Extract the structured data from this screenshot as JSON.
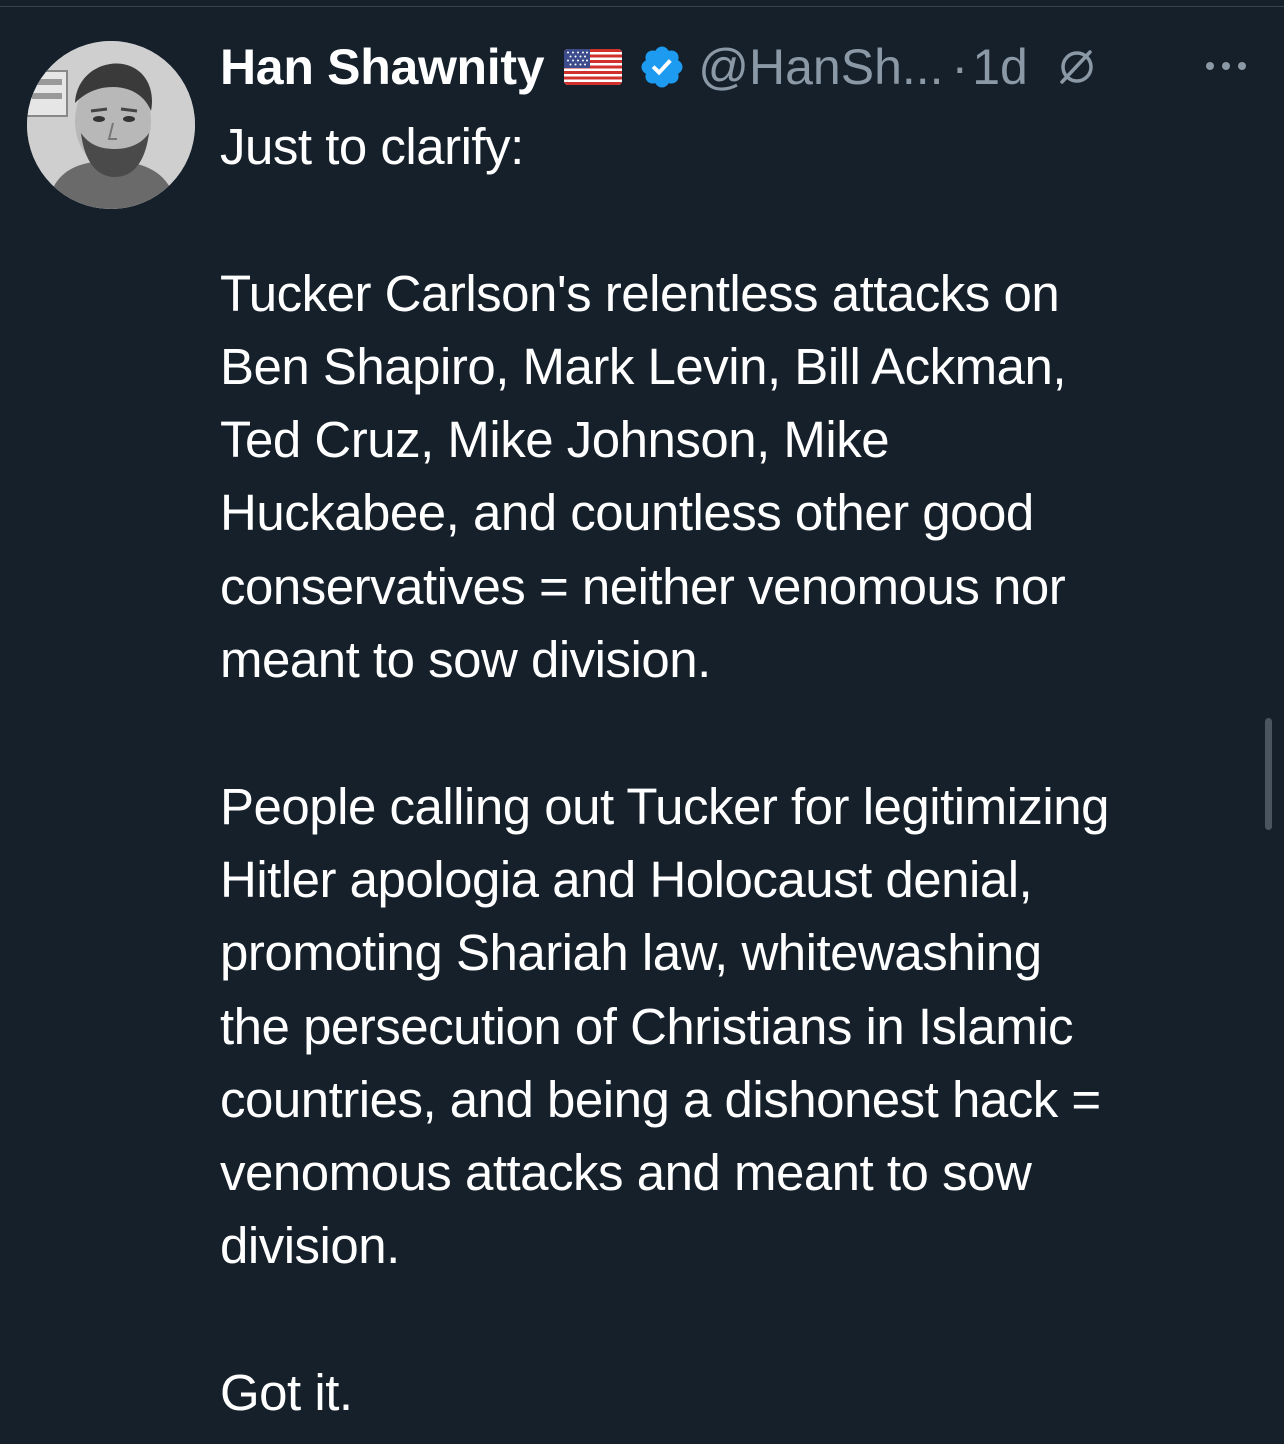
{
  "tweet": {
    "author": {
      "display_name": "Han Shawnity",
      "flag_emoji": "🇺🇸",
      "handle": "@HanSh...",
      "separator": "·",
      "timestamp": "1d",
      "avatar_icon": "profile-photo",
      "verified_icon": "verified-badge-icon",
      "verified_color": "#1d9bf0"
    },
    "more_icon": "more-horizontal-icon",
    "grok_icon": "slashed-circle-icon",
    "body": {
      "intro": "Just to clarify:",
      "p1_lines": [
        "Tucker Carlson's relentless attacks on",
        "Ben Shapiro, Mark Levin, Bill Ackman,",
        "Ted Cruz, Mike Johnson, Mike",
        "Huckabee, and countless other good",
        "conservatives = neither venomous nor",
        "meant to sow division."
      ],
      "p2_lines": [
        "People calling out Tucker for legitimizing",
        "Hitler apologia and Holocaust denial,",
        "promoting Shariah law, whitewashing",
        "the persecution of Christians in Islamic",
        "countries, and being a dishonest hack =",
        "venomous attacks and meant to sow",
        "division."
      ],
      "closing": "Got it."
    }
  },
  "colors": {
    "background": "#15202b",
    "text_primary": "#ffffff",
    "text_secondary": "#8b98a5",
    "accent": "#1d9bf0"
  }
}
